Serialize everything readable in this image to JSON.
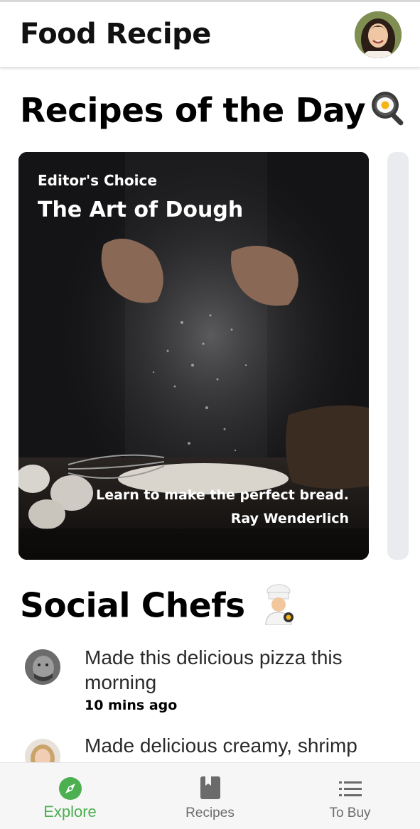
{
  "app_bar": {
    "title": "Food Recipe"
  },
  "recipes_of_day": {
    "heading": "Recipes of the Day",
    "heading_icon": "frying-pan-egg-icon",
    "cards": [
      {
        "eyebrow": "Editor's Choice",
        "title": "The Art of Dough",
        "description": "Learn to make the perfect bread.",
        "author": "Ray Wenderlich"
      }
    ]
  },
  "social_chefs": {
    "heading": "Social Chefs",
    "heading_icon": "woman-cook-icon",
    "posts": [
      {
        "message": "Made this delicious pizza this morning",
        "time": "10 mins ago"
      },
      {
        "message": "Made delicious creamy, shrimp",
        "time": ""
      }
    ]
  },
  "bottom_nav": {
    "items": [
      {
        "label": "Explore",
        "icon": "compass-icon",
        "active": true
      },
      {
        "label": "Recipes",
        "icon": "book-icon",
        "active": false
      },
      {
        "label": "To Buy",
        "icon": "list-icon",
        "active": false
      }
    ]
  },
  "colors": {
    "accent": "#4caf50",
    "inactive": "#6b6b6b",
    "card_background": "#0f0f10"
  }
}
